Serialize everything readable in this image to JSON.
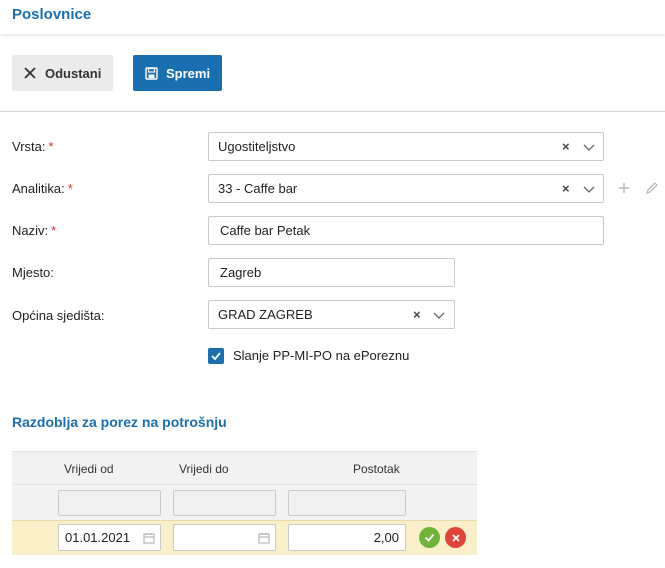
{
  "header": {
    "title": "Poslovnice"
  },
  "toolbar": {
    "cancel_label": "Odustani",
    "save_label": "Spremi"
  },
  "form": {
    "required_mark": "*",
    "vrsta": {
      "label": "Vrsta:",
      "value": "Ugostiteljstvo"
    },
    "analitika": {
      "label": "Analitika:",
      "value": "33 - Caffe bar"
    },
    "naziv": {
      "label": "Naziv:",
      "value": "Caffe bar Petak"
    },
    "mjesto": {
      "label": "Mjesto:",
      "value": "Zagreb"
    },
    "opcina": {
      "label": "Općina sjedišta:",
      "value": "GRAD ZAGREB"
    },
    "checkbox": {
      "label": "Slanje PP-MI-PO na ePoreznu",
      "checked": true
    }
  },
  "section": {
    "title": "Razdoblja za porez na potrošnju"
  },
  "table": {
    "columns": [
      "Vrijedi od",
      "Vrijedi do",
      "Postotak"
    ],
    "rows": [
      {
        "vrijedi_od": "01.01.2021",
        "vrijedi_do": "",
        "postotak": "2,00"
      }
    ]
  },
  "colors": {
    "accent": "#1a6fb0",
    "required": "#d0312d",
    "confirm": "#6fb33a",
    "cancel": "#e0433a",
    "editing_row": "#f9efc8"
  }
}
